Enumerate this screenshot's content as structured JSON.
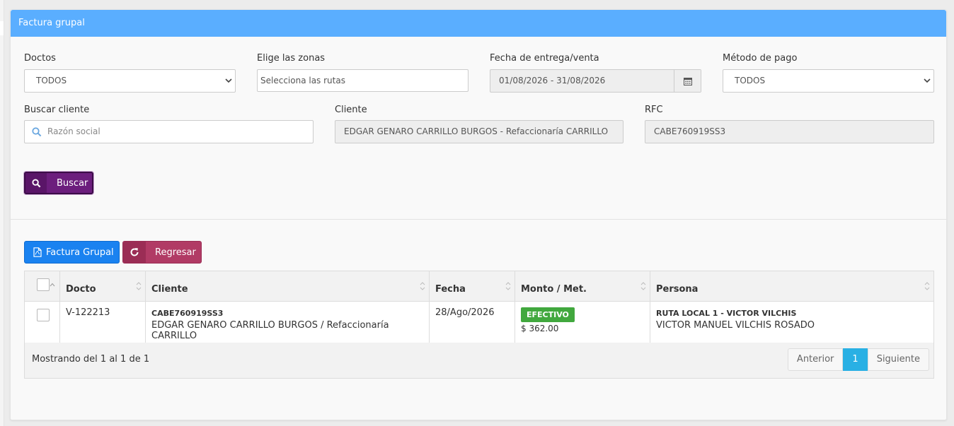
{
  "panel": {
    "title": "Factura grupal"
  },
  "filters": {
    "doctos": {
      "label": "Doctos",
      "value": "TODOS"
    },
    "zonas": {
      "label": "Elige las zonas",
      "placeholder": "Selecciona las rutas"
    },
    "fecha": {
      "label": "Fecha de entrega/venta",
      "value": "01/08/2026 - 31/08/2026"
    },
    "metodo": {
      "label": "Método de pago",
      "value": "TODOS"
    },
    "buscar_cliente": {
      "label": "Buscar cliente",
      "placeholder": "Razón social"
    },
    "cliente": {
      "label": "Cliente",
      "value": "EDGAR GENARO CARRILLO BURGOS - Refaccionaría CARRILLO"
    },
    "rfc": {
      "label": "RFC",
      "value": "CABE760919SS3"
    }
  },
  "actions": {
    "buscar_label": "Buscar",
    "factura_label": "Factura Grupal",
    "regresar_label": "Regresar"
  },
  "table": {
    "headers": {
      "docto": "Docto",
      "cliente": "Cliente",
      "fecha": "Fecha",
      "monto": "Monto / Met.",
      "persona": "Persona"
    },
    "rows": [
      {
        "docto": "V-122213",
        "rfc": "CABE760919SS3",
        "cliente": "EDGAR GENARO CARRILLO BURGOS / Refaccionaría CARRILLO",
        "fecha": "28/Ago/2026",
        "metodo": "EFECTIVO",
        "monto": "$ 362.00",
        "ruta": "RUTA LOCAL 1 - VICTOR VILCHIS",
        "persona": "VICTOR MANUEL VILCHIS ROSADO"
      }
    ]
  },
  "footer": {
    "info": "Mostrando del 1 al 1 de 1",
    "prev": "Anterior",
    "page": "1",
    "next": "Siguiente"
  },
  "colors": {
    "heading": "#5aaeff",
    "buscar": "#6c1e7d",
    "factura": "#1a82f0",
    "regresar": "#b13b65",
    "efectivo": "#41a83e",
    "page_active": "#29b0e4"
  }
}
